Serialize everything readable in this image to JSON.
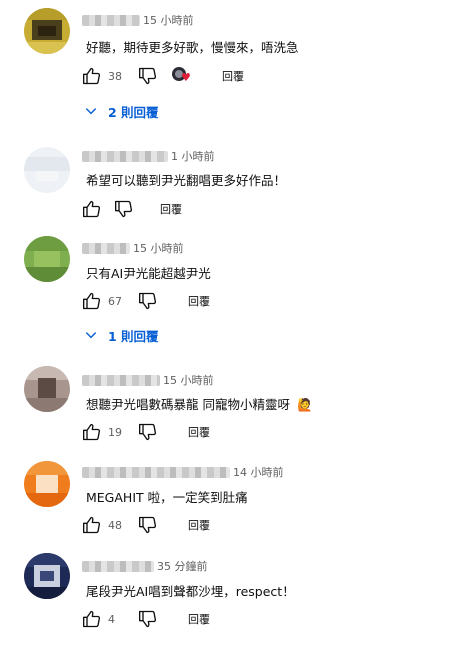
{
  "comments": [
    {
      "time": "15 小時前",
      "text": "好聽，期待更多好歌，慢慢來，唔洗急",
      "likes": "38",
      "reply_label": "回覆",
      "creator_heart": true,
      "replies_label": "2 則回覆"
    },
    {
      "time": "1 小時前",
      "text": "希望可以聽到尹光翻唱更多好作品！",
      "likes": "",
      "reply_label": "回覆"
    },
    {
      "time": "15 小時前",
      "text": "只有AI尹光能超越尹光",
      "likes": "67",
      "reply_label": "回覆",
      "replies_label": "1 則回覆"
    },
    {
      "time": "15 小時前",
      "text": "想聽尹光唱數碼暴龍 同寵物小精靈呀",
      "emoji": "🙋",
      "likes": "19",
      "reply_label": "回覆"
    },
    {
      "time": "14 小時前",
      "text": "MEGAHIT 啦，一定笑到肚痛",
      "likes": "48",
      "reply_label": "回覆"
    },
    {
      "time": "35 分鐘前",
      "text": "尾段尹光AI唱到聲都沙埋，respect！",
      "likes": "4",
      "reply_label": "回覆"
    }
  ],
  "icons": [
    "thumb-up-icon",
    "thumb-down-icon",
    "chevron-down-icon",
    "heart-icon"
  ],
  "colors": {
    "link": "#065fd4",
    "meta": "#606060",
    "heart": "#e0203a"
  }
}
